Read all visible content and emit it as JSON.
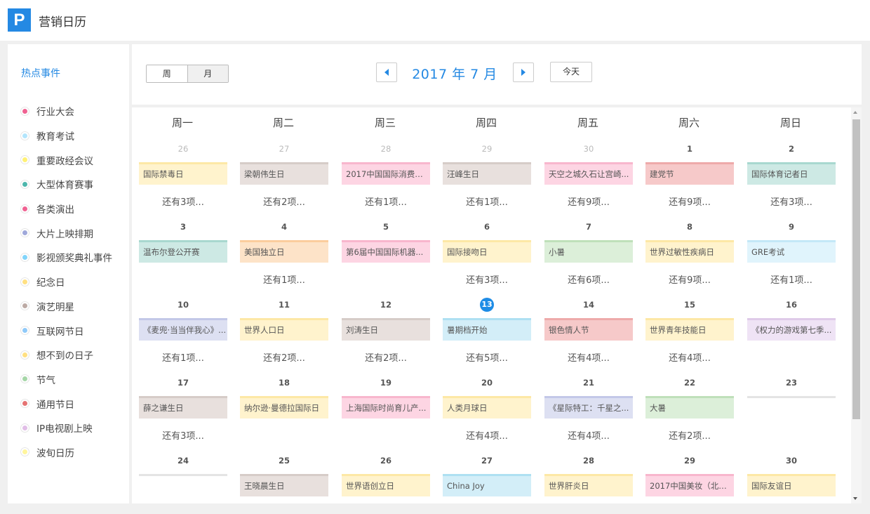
{
  "app": {
    "logo_letter": "P",
    "title": "营销日历"
  },
  "sidebar": {
    "title": "热点事件",
    "categories": [
      {
        "label": "行业大会",
        "color": "#f06292"
      },
      {
        "label": "教育考试",
        "color": "#b3e5fc"
      },
      {
        "label": "重要政经会议",
        "color": "#fff176"
      },
      {
        "label": "大型体育赛事",
        "color": "#4db6ac"
      },
      {
        "label": "各类演出",
        "color": "#f06292"
      },
      {
        "label": "大片上映排期",
        "color": "#9fa8da"
      },
      {
        "label": "影视颁奖典礼事件",
        "color": "#81d4fa"
      },
      {
        "label": "纪念日",
        "color": "#ffe082"
      },
      {
        "label": "演艺明星",
        "color": "#bcaaa4"
      },
      {
        "label": "互联网节日",
        "color": "#90caf9"
      },
      {
        "label": "想不到の日子",
        "color": "#ffe082"
      },
      {
        "label": "节气",
        "color": "#a5d6a7"
      },
      {
        "label": "通用节日",
        "color": "#e57373"
      },
      {
        "label": "IP电视剧上映",
        "color": "#e1bee7"
      },
      {
        "label": "波旬日历",
        "color": "#fff59d"
      }
    ]
  },
  "header": {
    "view_week": "周",
    "view_month": "月",
    "month_title": "2017 年 7 月",
    "today_label": "今天"
  },
  "calendar": {
    "weekdays": [
      "周一",
      "周二",
      "周三",
      "周四",
      "周五",
      "周六",
      "周日"
    ],
    "weeks": [
      [
        {
          "day": "26",
          "other": true,
          "event": "国际禁毒日",
          "bg": "#fff3cd",
          "border": "#fde8a6",
          "more": "还有3项..."
        },
        {
          "day": "27",
          "other": true,
          "event": "梁朝伟生日",
          "bg": "#e8e0dd",
          "border": "#d6ccc8",
          "more": "还有2项..."
        },
        {
          "day": "28",
          "other": true,
          "event": "2017中国国际消费电...",
          "bg": "#fdd5e3",
          "border": "#f8b6cd",
          "more": "还有1项..."
        },
        {
          "day": "29",
          "other": true,
          "event": "汪峰生日",
          "bg": "#e8e0dd",
          "border": "#d6ccc8",
          "more": "还有1项..."
        },
        {
          "day": "30",
          "other": true,
          "event": "天空之城久石让宫崎...",
          "bg": "#fdd5e3",
          "border": "#f8b6cd",
          "more": "还有9项..."
        },
        {
          "day": "1",
          "other": false,
          "event": "建党节",
          "bg": "#f6c9c9",
          "border": "#eeaaaa",
          "more": "还有9项..."
        },
        {
          "day": "2",
          "other": false,
          "event": "国际体育记者日",
          "bg": "#cde9e4",
          "border": "#a8d8cf",
          "more": "还有3项..."
        }
      ],
      [
        {
          "day": "3",
          "other": false,
          "event": "温布尔登公开赛",
          "bg": "#cde9e4",
          "border": "#a8d8cf",
          "more": ""
        },
        {
          "day": "4",
          "other": false,
          "event": "美国独立日",
          "bg": "#fde3c8",
          "border": "#fbcd9d",
          "more": "还有1项..."
        },
        {
          "day": "5",
          "other": false,
          "event": "第6届中国国际机器...",
          "bg": "#fdd5e3",
          "border": "#f8b6cd",
          "more": ""
        },
        {
          "day": "6",
          "other": false,
          "event": "国际接吻日",
          "bg": "#fff3cd",
          "border": "#fde8a6",
          "more": "还有3项..."
        },
        {
          "day": "7",
          "other": false,
          "event": "小暑",
          "bg": "#dcefd9",
          "border": "#bfe0ba",
          "more": "还有6项..."
        },
        {
          "day": "8",
          "other": false,
          "event": "世界过敏性疾病日",
          "bg": "#fff3cd",
          "border": "#fde8a6",
          "more": "还有9项..."
        },
        {
          "day": "9",
          "other": false,
          "event": "GRE考试",
          "bg": "#e0f4fc",
          "border": "#c3e8f7",
          "more": "还有1项..."
        }
      ],
      [
        {
          "day": "10",
          "other": false,
          "event": "《麦兜·当当伴我心》...",
          "bg": "#dde0f2",
          "border": "#c3c8e8",
          "more": "还有1项..."
        },
        {
          "day": "11",
          "other": false,
          "event": "世界人口日",
          "bg": "#fff3cd",
          "border": "#fde8a6",
          "more": "还有2项..."
        },
        {
          "day": "12",
          "other": false,
          "event": "刘涛生日",
          "bg": "#e8e0dd",
          "border": "#d6ccc8",
          "more": "还有2项..."
        },
        {
          "day": "13",
          "other": false,
          "today": true,
          "event": "暑期档开始",
          "bg": "#d3eef8",
          "border": "#aee0f2",
          "more": "还有5项..."
        },
        {
          "day": "14",
          "other": false,
          "event": "银色情人节",
          "bg": "#f6c9c9",
          "border": "#eeaaaa",
          "more": "还有4项..."
        },
        {
          "day": "15",
          "other": false,
          "event": "世界青年技能日",
          "bg": "#fff3cd",
          "border": "#fde8a6",
          "more": "还有4项..."
        },
        {
          "day": "16",
          "other": false,
          "event": "《权力的游戏第七季...",
          "bg": "#efe3f5",
          "border": "#dfcbe9",
          "more": ""
        }
      ],
      [
        {
          "day": "17",
          "other": false,
          "event": "薛之谦生日",
          "bg": "#e8e0dd",
          "border": "#d6ccc8",
          "more": "还有3项..."
        },
        {
          "day": "18",
          "other": false,
          "event": "纳尔逊·曼德拉国际日",
          "bg": "#fff3cd",
          "border": "#fde8a6",
          "more": ""
        },
        {
          "day": "19",
          "other": false,
          "event": "上海国际时尚育儿产...",
          "bg": "#fdd5e3",
          "border": "#f8b6cd",
          "more": ""
        },
        {
          "day": "20",
          "other": false,
          "event": "人类月球日",
          "bg": "#fff3cd",
          "border": "#fde8a6",
          "more": "还有4项..."
        },
        {
          "day": "21",
          "other": false,
          "event": "《星际特工：千星之...",
          "bg": "#dde0f2",
          "border": "#c3c8e8",
          "more": "还有4项..."
        },
        {
          "day": "22",
          "other": false,
          "event": "大暑",
          "bg": "#dcefd9",
          "border": "#bfe0ba",
          "more": "还有2项..."
        },
        {
          "day": "23",
          "other": false,
          "event": "",
          "bg": "",
          "border": "",
          "more": ""
        }
      ],
      [
        {
          "day": "24",
          "other": false,
          "event": "",
          "bg": "",
          "border": "",
          "more": ""
        },
        {
          "day": "25",
          "other": false,
          "event": "王晓晨生日",
          "bg": "#e8e0dd",
          "border": "#d6ccc8",
          "more": ""
        },
        {
          "day": "26",
          "other": false,
          "event": "世界语创立日",
          "bg": "#fff3cd",
          "border": "#fde8a6",
          "more": ""
        },
        {
          "day": "27",
          "other": false,
          "event": "China Joy",
          "bg": "#d3eef8",
          "border": "#aee0f2",
          "more": ""
        },
        {
          "day": "28",
          "other": false,
          "event": "世界肝炎日",
          "bg": "#fff3cd",
          "border": "#fde8a6",
          "more": ""
        },
        {
          "day": "29",
          "other": false,
          "event": "2017中国美妆（北京...",
          "bg": "#fdd5e3",
          "border": "#f8b6cd",
          "more": ""
        },
        {
          "day": "30",
          "other": false,
          "event": "国际友谊日",
          "bg": "#fff3cd",
          "border": "#fde8a6",
          "more": ""
        }
      ]
    ]
  }
}
